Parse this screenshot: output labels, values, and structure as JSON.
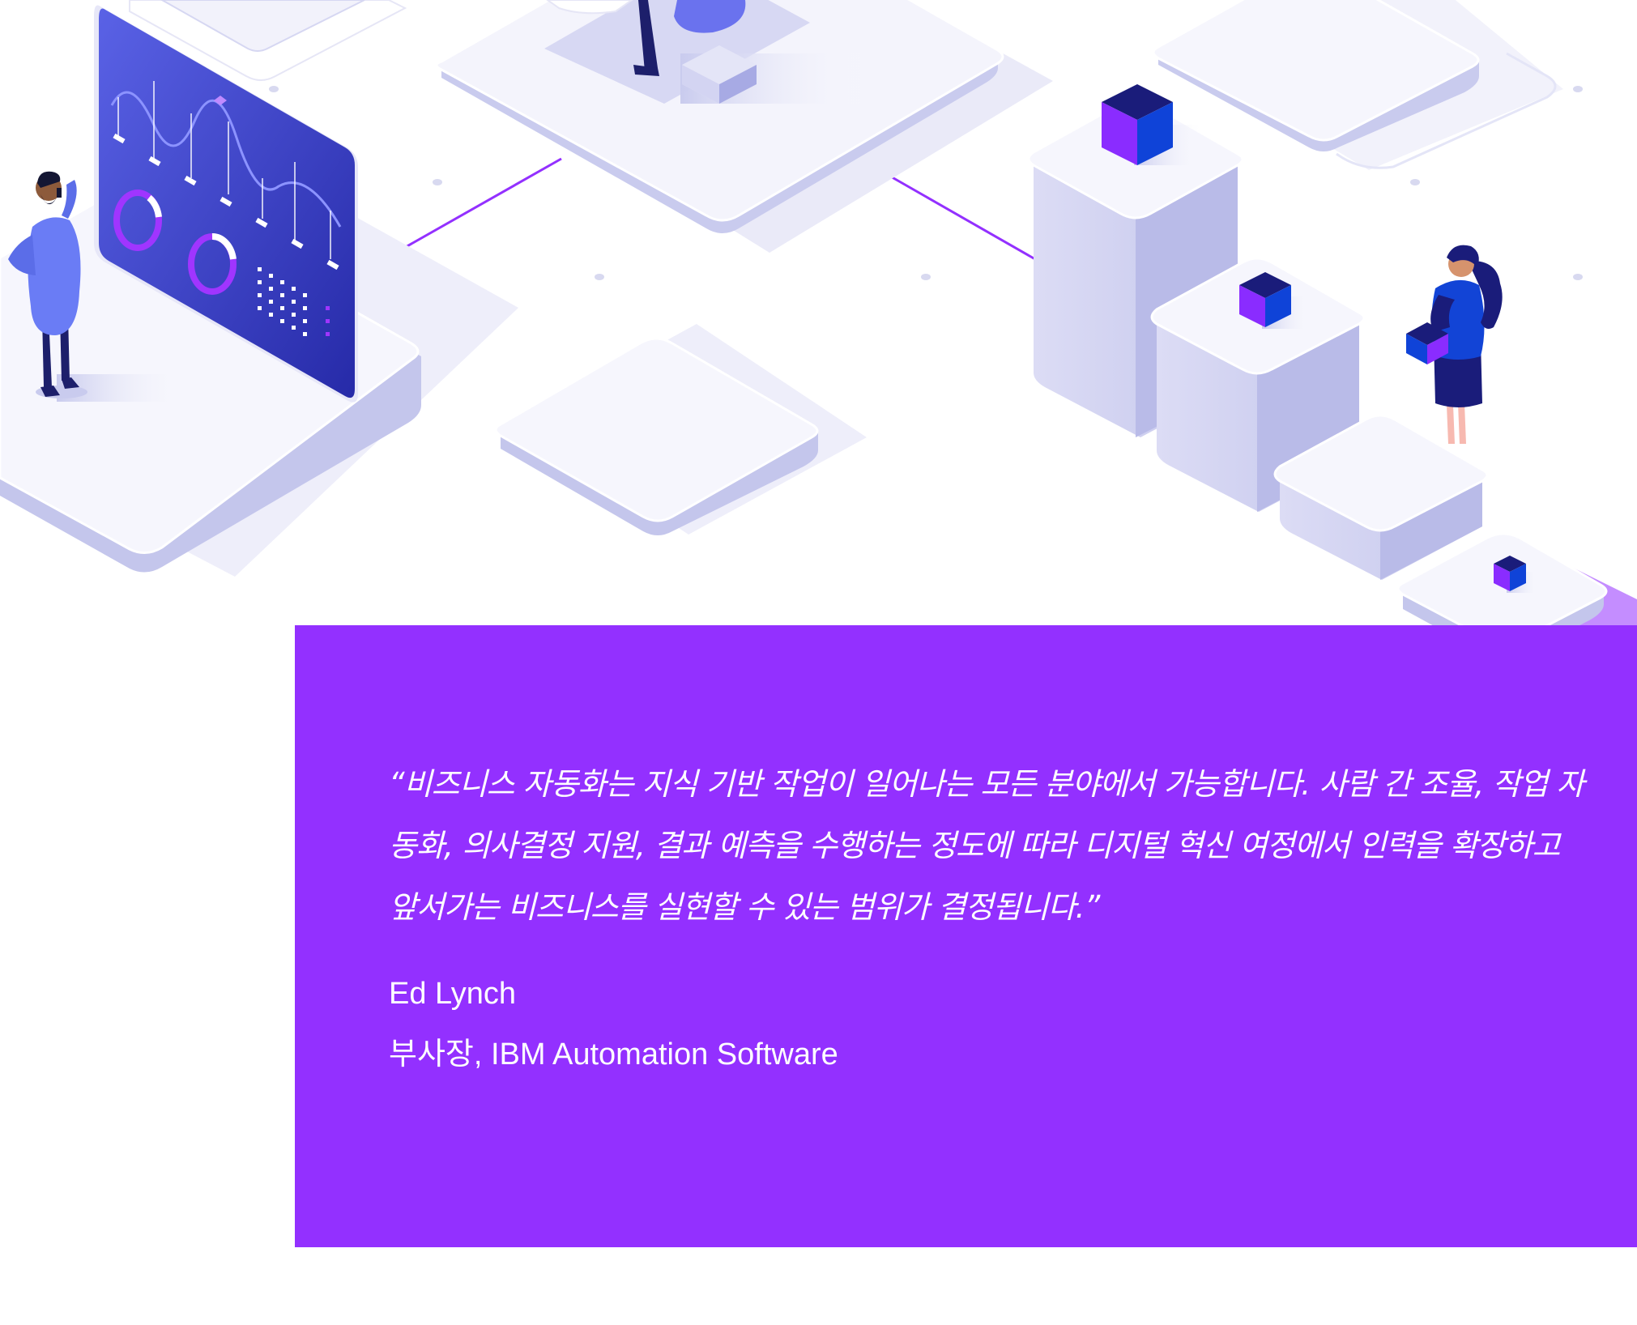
{
  "quote": {
    "text": "“비즈니스 자동화는 지식 기반 작업이 일어나는 모든 분야에서 가능합니다. 사람 간 조율, 작업 자동화, 의사결정 지원, 결과 예측을 수행하는 정도에 따라 디지털 혁신 여정에서 인력을 확장하고 앞서가는 비즈니스를 실현할 수 있는 범위가 결정됩니다.”",
    "author": "Ed Lynch",
    "author_title": "부사장, IBM Automation Software"
  },
  "colors": {
    "accent_purple": "#9330ff",
    "screen_blue": "#3b3fcf",
    "platform_light": "#f1f1fb",
    "platform_shadow": "#c9cbee",
    "cube_dark": "#1a1c7a",
    "cube_blue": "#0f43d8",
    "cube_purple": "#8a2cff"
  },
  "icons": {
    "dashboard_screen": "analytics-dashboard-illustration",
    "person_left": "person-on-phone-illustration",
    "person_right": "person-holding-cube-illustration",
    "cubes": "isometric-cube-illustration"
  }
}
